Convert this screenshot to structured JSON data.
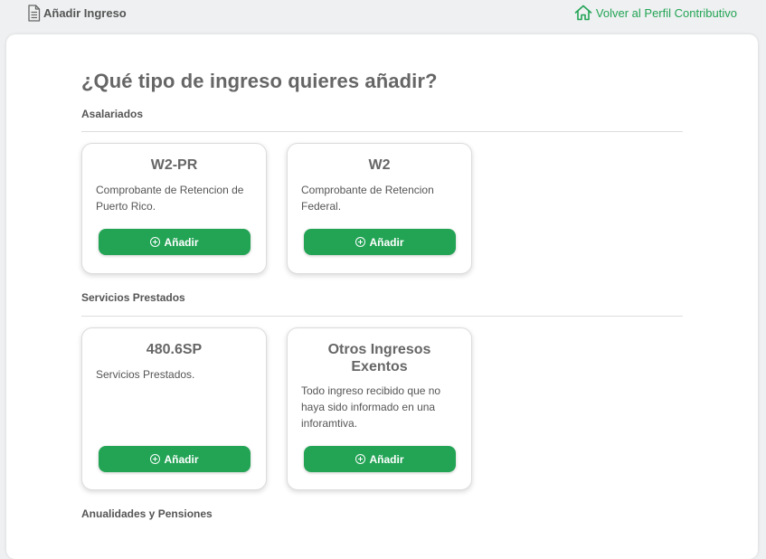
{
  "header": {
    "page_title": "Añadir Ingreso",
    "back_link": "Volver al Perfil Contributivo"
  },
  "main": {
    "question": "¿Qué tipo de ingreso quieres añadir?",
    "sections": [
      {
        "title": "Asalariados",
        "cards": [
          {
            "title": "W2-PR",
            "description": "Comprobante de Retencion de Puerto Rico.",
            "button": "Añadir"
          },
          {
            "title": "W2",
            "description": "Comprobante de Retencion Federal.",
            "button": "Añadir"
          }
        ]
      },
      {
        "title": "Servicios Prestados",
        "cards": [
          {
            "title": "480.6SP",
            "description": "Servicios Prestados.",
            "button": "Añadir"
          },
          {
            "title": "Otros Ingresos Exentos",
            "description": "Todo ingreso recibido que no haya sido informado en una inforamtiva.",
            "button": "Añadir"
          }
        ]
      },
      {
        "title": "Anualidades y Pensiones",
        "cards": []
      }
    ]
  },
  "colors": {
    "accent": "#23a455",
    "background": "#eef0f1",
    "panel": "#ffffff"
  }
}
